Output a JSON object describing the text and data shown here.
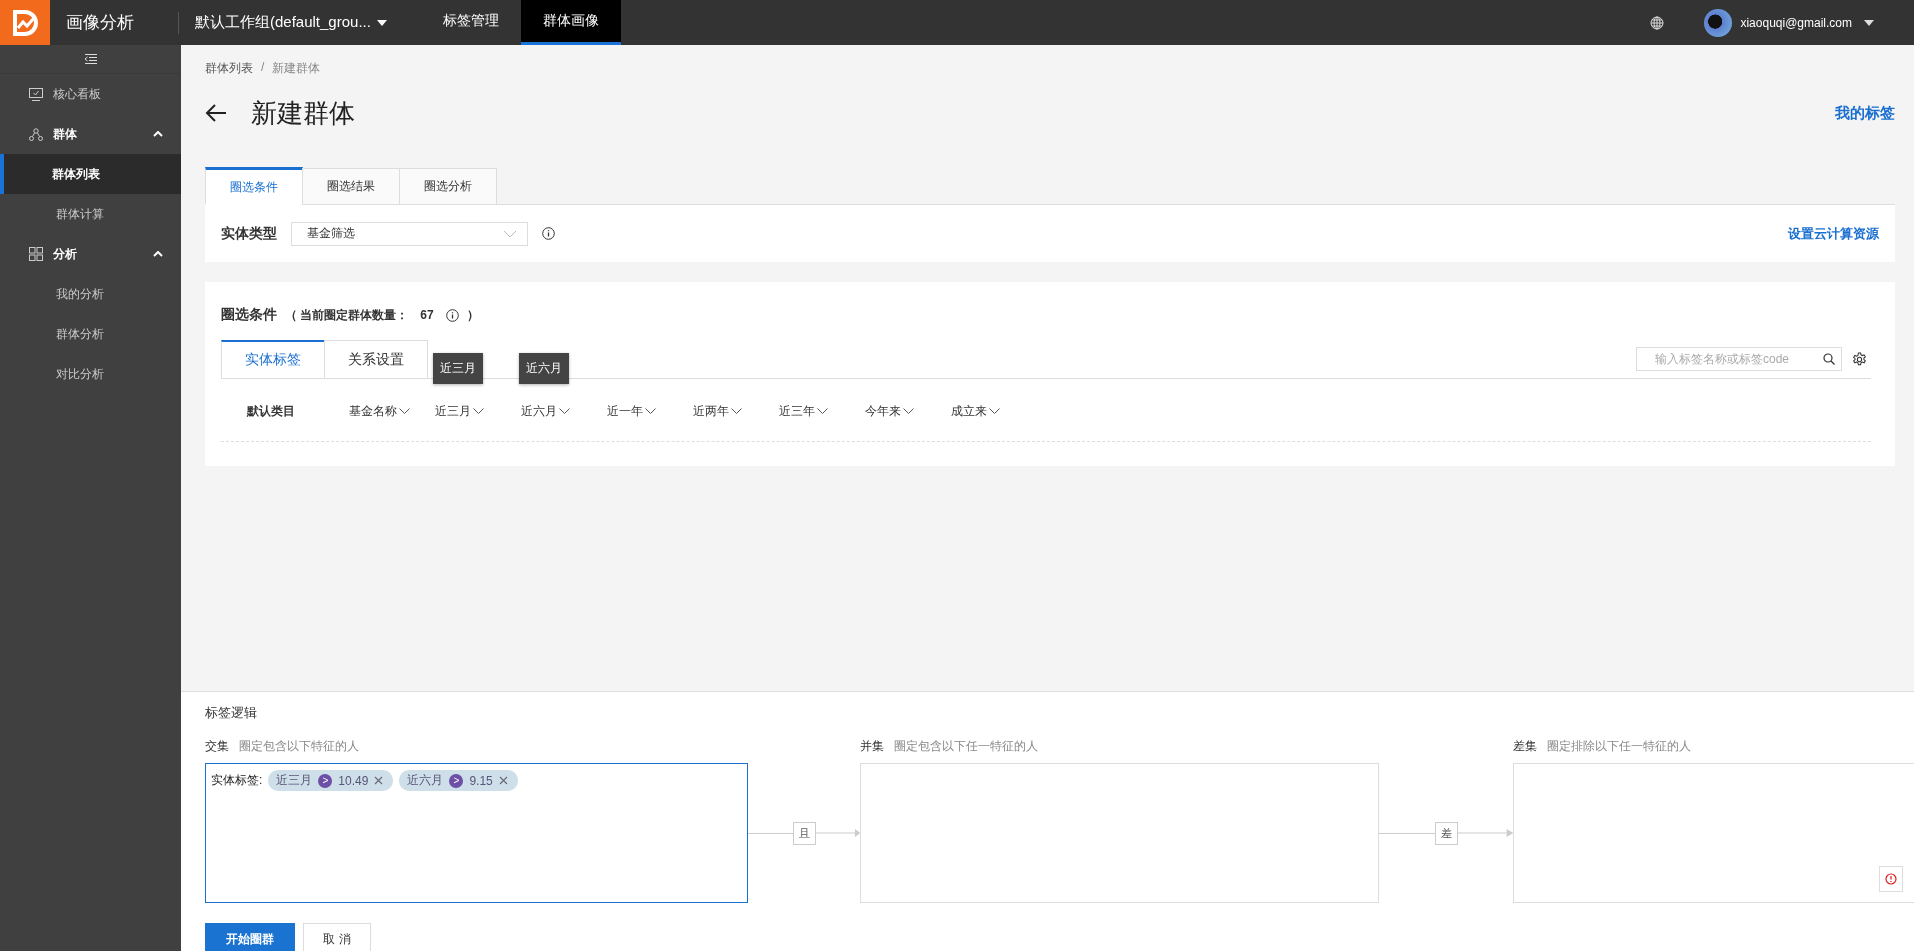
{
  "app": {
    "name": "画像分析"
  },
  "workspace": {
    "label": "默认工作组(default_grou..."
  },
  "nav": [
    {
      "label": "标签管理",
      "selected": false
    },
    {
      "label": "群体画像",
      "selected": true
    }
  ],
  "user": {
    "email": "xiaoquqi@gmail.com"
  },
  "sidebar": {
    "items": [
      {
        "kind": "link",
        "label": "核心看板"
      },
      {
        "kind": "group",
        "label": "群体",
        "expanded": true,
        "children": [
          {
            "label": "群体列表",
            "selected": true
          },
          {
            "label": "群体计算",
            "selected": false
          }
        ]
      },
      {
        "kind": "group",
        "label": "分析",
        "expanded": true,
        "children": [
          {
            "label": "我的分析",
            "selected": false
          },
          {
            "label": "群体分析",
            "selected": false
          },
          {
            "label": "对比分析",
            "selected": false
          }
        ]
      }
    ]
  },
  "breadcrumb": {
    "items": [
      "群体列表",
      "新建群体"
    ],
    "separator": "/"
  },
  "page": {
    "title": "新建群体",
    "link": "我的标签"
  },
  "tabs": [
    {
      "label": "圈选条件",
      "selected": true
    },
    {
      "label": "圈选结果",
      "selected": false
    },
    {
      "label": "圈选分析",
      "selected": false
    }
  ],
  "entity_type": {
    "label": "实体类型",
    "value": "基金筛选",
    "link": "设置云计算资源"
  },
  "conditions": {
    "title": "圈选条件",
    "count_prefix": "（ 当前圈定群体数量：",
    "count": "67",
    "count_suffix": "）",
    "subtabs": [
      {
        "label": "实体标签",
        "selected": true
      },
      {
        "label": "关系设置",
        "selected": false
      }
    ],
    "search": {
      "placeholder": "输入标签名称或标签code"
    },
    "columns": [
      {
        "kind": "category",
        "label": "默认类目"
      },
      {
        "kind": "filter",
        "label": "基金名称"
      },
      {
        "kind": "filter",
        "label": "近三月",
        "tooltip": "近三月"
      },
      {
        "kind": "filter",
        "label": "近六月",
        "tooltip": "近六月"
      },
      {
        "kind": "filter",
        "label": "近一年"
      },
      {
        "kind": "filter",
        "label": "近两年"
      },
      {
        "kind": "filter",
        "label": "近三年"
      },
      {
        "kind": "filter",
        "label": "今年来"
      },
      {
        "kind": "filter",
        "label": "成立来"
      }
    ]
  },
  "logic": {
    "title": "标签逻辑",
    "sets": [
      {
        "label": "交集",
        "hint": "圈定包含以下特征的人",
        "selected": true,
        "group": {
          "label": "实体标签:",
          "tags": [
            {
              "name": "近三月",
              "op": ">",
              "value": "10.49"
            },
            {
              "name": "近六月",
              "op": ">",
              "value": "9.15"
            }
          ]
        }
      },
      {
        "label": "并集",
        "hint": "圈定包含以下任一特征的人",
        "selected": false,
        "connector": "且"
      },
      {
        "label": "差集",
        "hint": "圈定排除以下任一特征的人",
        "selected": false,
        "connector": "差",
        "warning": true
      }
    ]
  },
  "buttons": [
    {
      "label": "开始圈群",
      "kind": "primary"
    },
    {
      "label": "取 消",
      "kind": "default"
    }
  ]
}
